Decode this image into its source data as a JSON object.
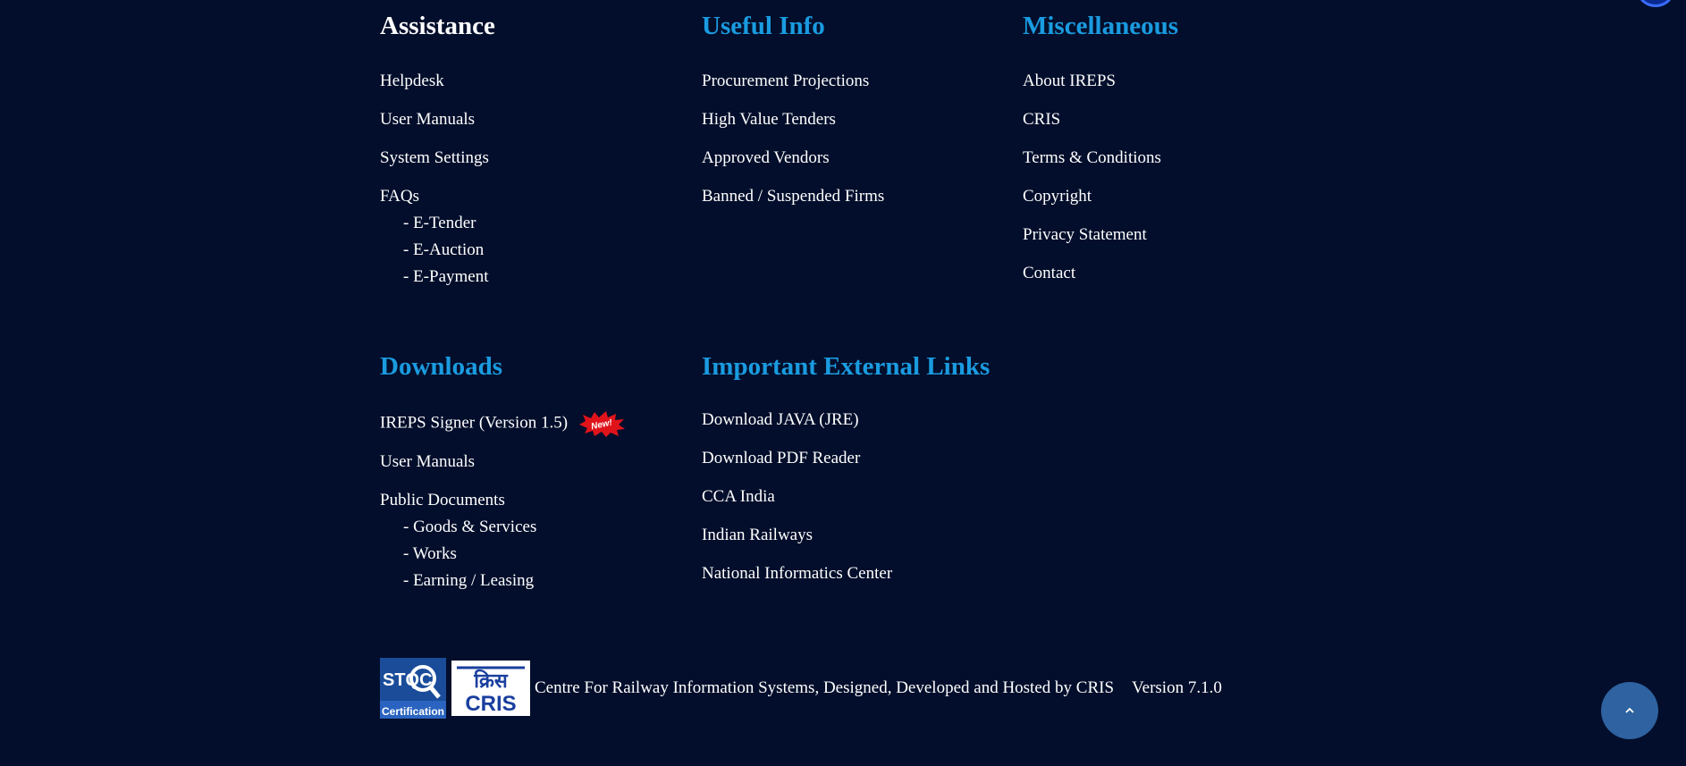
{
  "colors": {
    "background": "#020e2b",
    "heading_accent": "#1a9be0",
    "heading_primary": "#ffffff",
    "text": "#ffffff",
    "scroll_top_button": "#2e62a0",
    "badge_red": "#e0131b"
  },
  "assistance": {
    "heading": "Assistance",
    "helpdesk": "Helpdesk",
    "user_manuals": "User Manuals",
    "system_settings": "System Settings",
    "faqs": "FAQs",
    "faq_etender": "- E-Tender",
    "faq_eauction": "- E-Auction",
    "faq_epayment": "- E-Payment"
  },
  "useful_info": {
    "heading": "Useful Info",
    "procurement_projections": "Procurement Projections",
    "high_value_tenders": "High Value Tenders",
    "approved_vendors": "Approved Vendors",
    "banned_firms": "Banned / Suspended Firms"
  },
  "miscellaneous": {
    "heading": "Miscellaneous",
    "about_ireps": "About IREPS",
    "cris": "CRIS",
    "terms": "Terms & Conditions",
    "copyright": "Copyright",
    "privacy": "Privacy Statement",
    "contact": "Contact"
  },
  "downloads": {
    "heading": "Downloads",
    "ireps_signer": "IREPS Signer (Version 1.5)",
    "new_badge": "New!",
    "user_manuals": "User Manuals",
    "public_documents": "Public Documents",
    "goods_services": "- Goods & Services",
    "works": "- Works",
    "earning_leasing": "- Earning / Leasing"
  },
  "external_links": {
    "heading": "Important External Links",
    "java": "Download JAVA (JRE)",
    "pdf_reader": "Download PDF Reader",
    "cca_india": "CCA India",
    "indian_railways": "Indian Railways",
    "nic": "National Informatics Center"
  },
  "footer": {
    "stqc_logo_text": "STQC",
    "stqc_logo_sub": "Certification",
    "cris_logo_hindi": "क्रिस",
    "cris_logo_text": "CRIS",
    "credit": "Centre For Railway Information Systems, Designed, Developed and Hosted by CRIS",
    "version": "Version 7.1.0"
  },
  "icons": {
    "scroll_top": "chevron-up-icon",
    "new_badge": "starburst-new-badge"
  }
}
